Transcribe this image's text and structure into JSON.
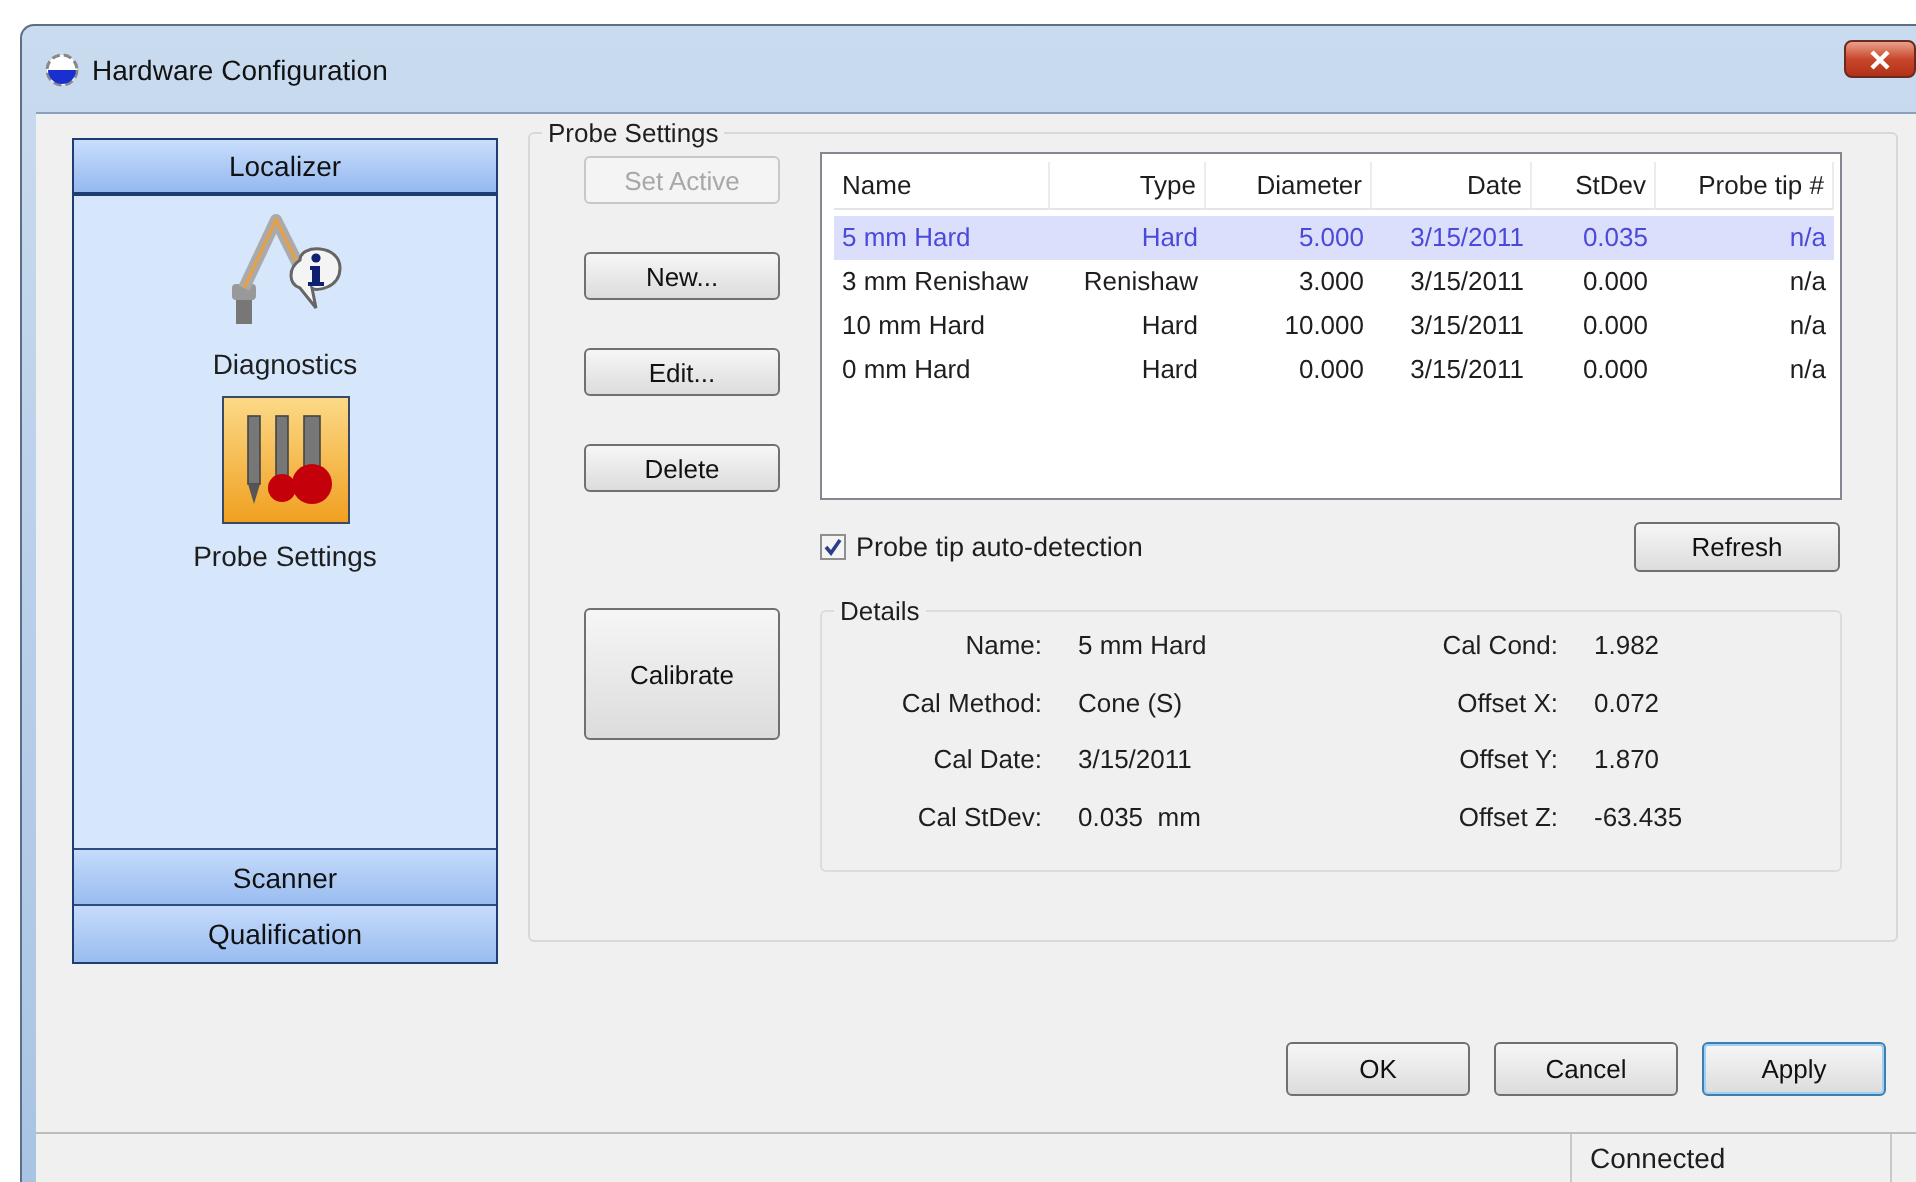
{
  "window": {
    "title": "Hardware Configuration"
  },
  "sidebar": {
    "sections": [
      {
        "label": "Localizer",
        "expanded": true,
        "items": [
          {
            "label": "Diagnostics",
            "selected": false
          },
          {
            "label": "Probe Settings",
            "selected": true
          }
        ]
      },
      {
        "label": "Scanner",
        "expanded": false
      },
      {
        "label": "Qualification",
        "expanded": false
      }
    ]
  },
  "probe_settings": {
    "title": "Probe Settings",
    "buttons": [
      {
        "label": "Set Active",
        "disabled": true
      },
      {
        "label": "New...",
        "disabled": false
      },
      {
        "label": "Edit...",
        "disabled": false
      },
      {
        "label": "Delete",
        "disabled": false
      }
    ],
    "calibrate": "Calibrate",
    "table": {
      "columns": [
        "Name",
        "Type",
        "Diameter",
        "Date",
        "StDev",
        "Probe tip #"
      ],
      "rows": [
        {
          "cells": [
            "5 mm Hard",
            "Hard",
            "5.000",
            "3/15/2011",
            "0.035",
            "n/a"
          ],
          "selected": true
        },
        {
          "cells": [
            "3 mm Renishaw",
            "Renishaw",
            "3.000",
            "3/15/2011",
            "0.000",
            "n/a"
          ],
          "selected": false
        },
        {
          "cells": [
            "10 mm Hard",
            "Hard",
            "10.000",
            "3/15/2011",
            "0.000",
            "n/a"
          ],
          "selected": false
        },
        {
          "cells": [
            "0 mm Hard",
            "Hard",
            "0.000",
            "3/15/2011",
            "0.000",
            "n/a"
          ],
          "selected": false
        }
      ]
    },
    "auto_detect": {
      "label": "Probe tip auto-detection",
      "checked": true
    },
    "refresh": "Refresh",
    "details": {
      "title": "Details",
      "fields": [
        {
          "label": "Name:",
          "value": "5 mm Hard"
        },
        {
          "label": "Cal Cond:",
          "value": "1.982"
        },
        {
          "label": "Cal Method:",
          "value": "Cone (S)"
        },
        {
          "label": "Offset X:",
          "value": "0.072"
        },
        {
          "label": "Cal Date:",
          "value": "3/15/2011"
        },
        {
          "label": "Offset Y:",
          "value": "1.870"
        },
        {
          "label": "Cal StDev:",
          "value": "0.035  mm"
        },
        {
          "label": "Offset Z:",
          "value": "-63.435"
        }
      ]
    }
  },
  "buttons": [
    {
      "label": "OK",
      "default": false
    },
    {
      "label": "Cancel",
      "default": false
    },
    {
      "label": "Apply",
      "default": true
    }
  ],
  "status_bar": {
    "text": "Connected"
  }
}
